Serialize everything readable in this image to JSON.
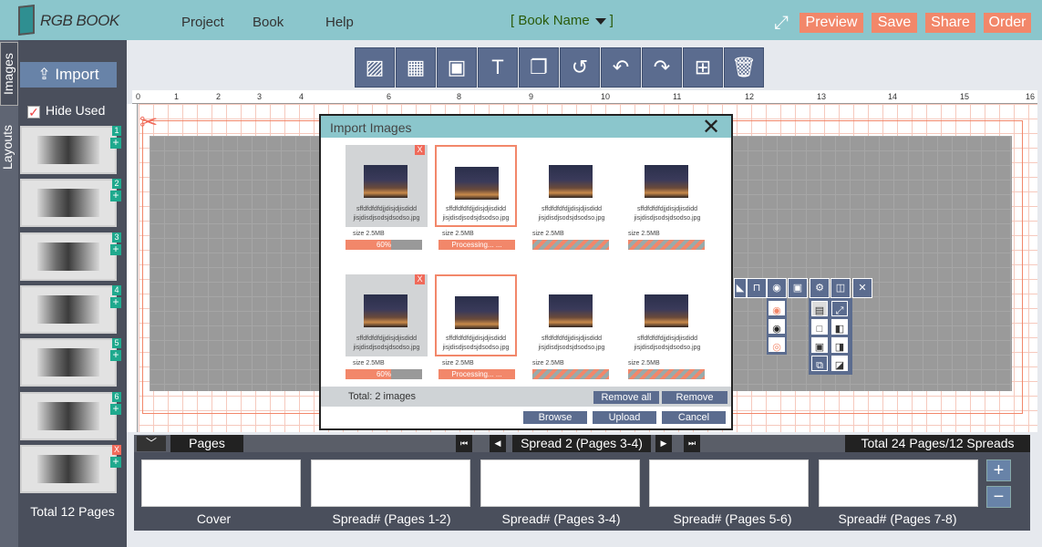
{
  "app": {
    "logo_text": "RGB BOOK"
  },
  "menu": {
    "project": "Project",
    "book": "Book",
    "help": "Help"
  },
  "book_selector": {
    "label": "[ Book  Name",
    "close": "]"
  },
  "header_buttons": {
    "preview": "Preview",
    "save": "Save",
    "share": "Share",
    "order": "Order"
  },
  "side_tabs": {
    "images": "Images",
    "layouts": "Layouts"
  },
  "left_panel": {
    "import_label": "Import",
    "hide_used_label": "Hide Used",
    "thumbnails": [
      {
        "badge": "1",
        "plus": "+"
      },
      {
        "badge": "2",
        "plus": "+"
      },
      {
        "badge": "3",
        "plus": "+"
      },
      {
        "badge": "4",
        "plus": "+"
      },
      {
        "badge": "5",
        "plus": "+"
      },
      {
        "badge": "6",
        "plus": "+"
      },
      {
        "badge": "X",
        "plus": "+"
      }
    ],
    "total_pages": "Total 12 Pages"
  },
  "ruler": {
    "marks": [
      "0",
      "1",
      "2",
      "3",
      "4",
      "5",
      "6",
      "7",
      "8",
      "9",
      "10",
      "11",
      "12",
      "13",
      "14",
      "15",
      "16"
    ]
  },
  "bottom_nav": {
    "pages_label": "Pages",
    "spread_label": "Spread 2 (Pages 3-4)",
    "total_label": "Total 24 Pages/12 Spreads"
  },
  "page_strip": {
    "cards": [
      "Cover",
      "Spread# (Pages 1-2)",
      "Spread# (Pages 3-4)",
      "Spread# (Pages 5-6)",
      "Spread# (Pages 7-8)"
    ]
  },
  "modal": {
    "title": "Import Images",
    "images": [
      {
        "name_line1": "sffdfdfdfdjjdisjdjisdidd",
        "name_line2": "jisjdisdjsodsjdsodso.jpg",
        "size": "size 2.5MB",
        "progress_text": "60%",
        "progress": 0.6,
        "state": "uploading"
      },
      {
        "name_line1": "sffdfdfdfdjjdisjdjisdidd",
        "name_line2": "jisjdisdjsodsjdsodso.jpg",
        "size": "size 2.5MB",
        "progress_text": "Processing... ...",
        "progress": 1.0,
        "state": "processing"
      },
      {
        "name_line1": "sffdfdfdfdjjdisjdjisdidd",
        "name_line2": "jisjdisdjsodsjdsodso.jpg",
        "size": "size 2.5MB",
        "progress_text": "",
        "state": "queued"
      },
      {
        "name_line1": "sffdfdfdfdjjdisjdjisdidd",
        "name_line2": "jisjdisdjsodsjdsodso.jpg",
        "size": "size 2.5MB",
        "progress_text": "",
        "state": "queued"
      },
      {
        "name_line1": "sffdfdfdfdjjdisjdjisdidd",
        "name_line2": "jisjdisdjsodsjdsodso.jpg",
        "size": "size 2.5MB",
        "progress_text": "60%",
        "progress": 0.6,
        "state": "uploading"
      },
      {
        "name_line1": "sffdfdfdfdjjdisjdjisdidd",
        "name_line2": "jisjdisdjsodsjdsodso.jpg",
        "size": "size 2.5MB",
        "progress_text": "Processing... ...",
        "progress": 1.0,
        "state": "processing"
      },
      {
        "name_line1": "sffdfdfdfdjjdisjdjisdidd",
        "name_line2": "jisjdisdjsodsjdsodso.jpg",
        "size": "size 2.5MB",
        "progress_text": "",
        "state": "queued"
      },
      {
        "name_line1": "sffdfdfdfdjjdisjdjisdidd",
        "name_line2": "jisjdisdjsodsjdsodso.jpg",
        "size": "size 2.5MB",
        "progress_text": "",
        "state": "queued"
      }
    ],
    "total_text": "Total:  2 images",
    "remove_all": "Remove all",
    "remove": "Remove",
    "browse": "Browse",
    "upload": "Upload",
    "cancel": "Cancel"
  },
  "colors": {
    "header": "#8bc6cc",
    "accent": "#f2876a",
    "button": "#5b6c8f",
    "panel": "#4a4f5c",
    "teal_badge": "#1fa98e"
  }
}
